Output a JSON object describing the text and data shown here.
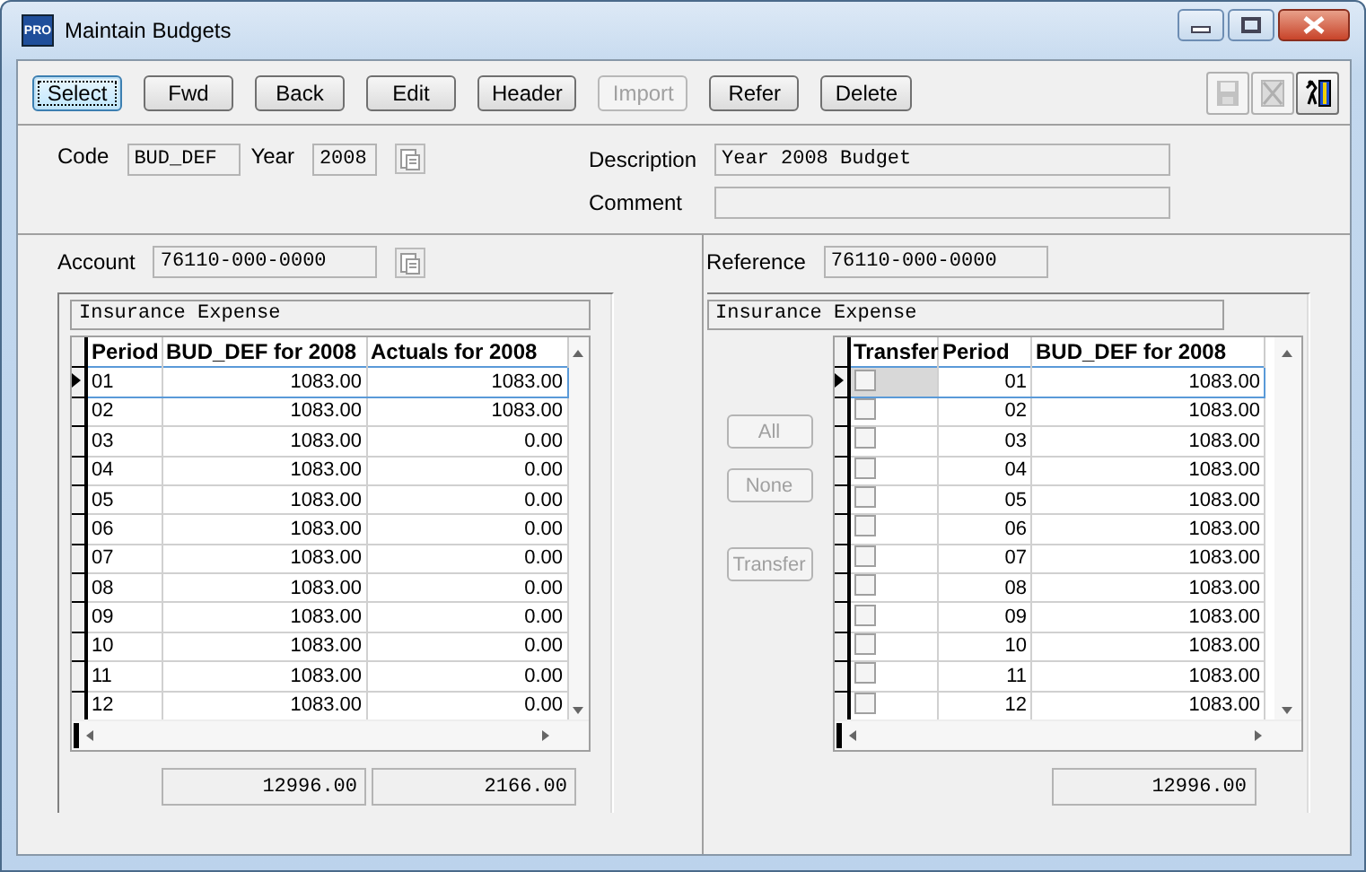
{
  "window": {
    "title": "Maintain Budgets",
    "icon_text": "PRO"
  },
  "toolbar": {
    "buttons": [
      {
        "label": "Select",
        "disabled": false,
        "focused": true
      },
      {
        "label": "Fwd",
        "disabled": false,
        "focused": false
      },
      {
        "label": "Back",
        "disabled": false,
        "focused": false
      },
      {
        "label": "Edit",
        "disabled": false,
        "focused": false
      },
      {
        "label": "Header",
        "disabled": false,
        "focused": false
      },
      {
        "label": "Import",
        "disabled": true,
        "focused": false
      },
      {
        "label": "Refer",
        "disabled": false,
        "focused": false
      },
      {
        "label": "Delete",
        "disabled": false,
        "focused": false
      }
    ],
    "icon_buttons": [
      {
        "kind": "save",
        "disabled": true
      },
      {
        "kind": "cancel",
        "disabled": true
      },
      {
        "kind": "exit",
        "disabled": false
      }
    ]
  },
  "header": {
    "code": {
      "label": "Code",
      "value": "BUD_DEF"
    },
    "year": {
      "label": "Year",
      "value": "2008"
    },
    "description": {
      "label": "Description",
      "value": "Year 2008 Budget"
    },
    "comment": {
      "label": "Comment"
    }
  },
  "left": {
    "account": {
      "label": "Account",
      "value": "76110-000-0000"
    },
    "grid": {
      "caption": "Insurance Expense",
      "columns": [
        "Period",
        "BUD_DEF for 2008",
        "Actuals for 2008"
      ],
      "rows": [
        {
          "selected": true,
          "cells": [
            "01",
            "1083.00",
            "1083.00"
          ]
        },
        {
          "selected": false,
          "cells": [
            "02",
            "1083.00",
            "1083.00"
          ]
        },
        {
          "selected": false,
          "cells": [
            "03",
            "1083.00",
            "0.00"
          ]
        },
        {
          "selected": false,
          "cells": [
            "04",
            "1083.00",
            "0.00"
          ]
        },
        {
          "selected": false,
          "cells": [
            "05",
            "1083.00",
            "0.00"
          ]
        },
        {
          "selected": false,
          "cells": [
            "06",
            "1083.00",
            "0.00"
          ]
        },
        {
          "selected": false,
          "cells": [
            "07",
            "1083.00",
            "0.00"
          ]
        },
        {
          "selected": false,
          "cells": [
            "08",
            "1083.00",
            "0.00"
          ]
        },
        {
          "selected": false,
          "cells": [
            "09",
            "1083.00",
            "0.00"
          ]
        },
        {
          "selected": false,
          "cells": [
            "10",
            "1083.00",
            "0.00"
          ]
        },
        {
          "selected": false,
          "cells": [
            "11",
            "1083.00",
            "0.00"
          ]
        },
        {
          "selected": false,
          "cells": [
            "12",
            "1083.00",
            "0.00"
          ]
        }
      ]
    },
    "totals": [
      "12996.00",
      "2166.00"
    ]
  },
  "right": {
    "reference": {
      "label": "Reference",
      "value": "76110-000-0000"
    },
    "side_buttons": [
      {
        "label": "All",
        "disabled": true
      },
      {
        "label": "None",
        "disabled": true
      },
      {
        "label": "Transfer",
        "disabled": true
      }
    ],
    "grid": {
      "caption": "Insurance Expense",
      "columns": [
        "Transfer",
        "Period",
        "BUD_DEF for 2008"
      ],
      "rows": [
        {
          "selected": true,
          "checked": false,
          "cells": [
            "",
            "01",
            "1083.00"
          ]
        },
        {
          "selected": false,
          "checked": false,
          "cells": [
            "",
            "02",
            "1083.00"
          ]
        },
        {
          "selected": false,
          "checked": false,
          "cells": [
            "",
            "03",
            "1083.00"
          ]
        },
        {
          "selected": false,
          "checked": false,
          "cells": [
            "",
            "04",
            "1083.00"
          ]
        },
        {
          "selected": false,
          "checked": false,
          "cells": [
            "",
            "05",
            "1083.00"
          ]
        },
        {
          "selected": false,
          "checked": false,
          "cells": [
            "",
            "06",
            "1083.00"
          ]
        },
        {
          "selected": false,
          "checked": false,
          "cells": [
            "",
            "07",
            "1083.00"
          ]
        },
        {
          "selected": false,
          "checked": false,
          "cells": [
            "",
            "08",
            "1083.00"
          ]
        },
        {
          "selected": false,
          "checked": false,
          "cells": [
            "",
            "09",
            "1083.00"
          ]
        },
        {
          "selected": false,
          "checked": false,
          "cells": [
            "",
            "10",
            "1083.00"
          ]
        },
        {
          "selected": false,
          "checked": false,
          "cells": [
            "",
            "11",
            "1083.00"
          ]
        },
        {
          "selected": false,
          "checked": false,
          "cells": [
            "",
            "12",
            "1083.00"
          ]
        }
      ]
    },
    "totals": [
      "12996.00"
    ]
  }
}
